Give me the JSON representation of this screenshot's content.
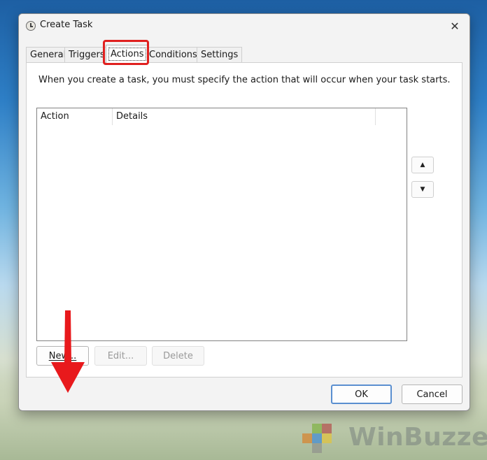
{
  "window": {
    "title": "Create Task",
    "icon": "clock-icon",
    "close_glyph": "✕"
  },
  "tabs": [
    {
      "label": "General",
      "active": false
    },
    {
      "label": "Triggers",
      "active": false
    },
    {
      "label": "Actions",
      "active": true
    },
    {
      "label": "Conditions",
      "active": false
    },
    {
      "label": "Settings",
      "active": false
    }
  ],
  "actions_tab": {
    "description": "When you create a task, you must specify the action that will occur when your task starts.",
    "list": {
      "columns": [
        "Action",
        "Details"
      ],
      "rows": []
    },
    "move_up_glyph": "▲",
    "move_down_glyph": "▼",
    "buttons": {
      "new": "New...",
      "edit": "Edit...",
      "delete": "Delete"
    }
  },
  "footer": {
    "ok": "OK",
    "cancel": "Cancel"
  },
  "annotation": {
    "highlight_color": "#e0201f",
    "arrow_color": "#e8191c"
  },
  "watermark": {
    "text": "WinBuzzer"
  }
}
